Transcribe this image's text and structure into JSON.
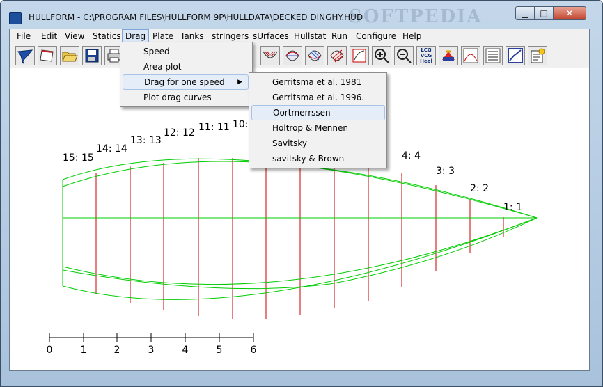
{
  "window": {
    "title": "HULLFORM - C:\\PROGRAM FILES\\HULLFORM 9P\\HULLDATA\\DECKED DINGHY.HUD",
    "watermark": "SOFTPEDIA"
  },
  "menubar": [
    "File",
    "Edit",
    "View",
    "Statics",
    "Drag",
    "Plate",
    "Tanks",
    "strIngers",
    "sUrfaces",
    "Hullstat",
    "Run",
    "Configure",
    "Help"
  ],
  "toolbar": {
    "icons": [
      "hull-3d-icon",
      "page-icon",
      "open-folder-icon",
      "save-disk-icon",
      "print-icon",
      "view-icon",
      "view-icon",
      "view-icon",
      "view-icon",
      "view-icon",
      "body-plan-icon",
      "plan-view-icon",
      "profile-icon",
      "lines-icon",
      "curve-plot-icon",
      "zoom-in-icon",
      "zoom-out-icon",
      "lcg-vcg-heel-icon",
      "stability-icon",
      "area-curve-icon",
      "data-table-icon",
      "speed-plot-icon",
      "export-icon"
    ],
    "lcg_label": "LCG VCG Heel"
  },
  "drag_menu": {
    "items": [
      "Speed",
      "Area plot",
      "Drag for one speed",
      "Plot drag curves"
    ],
    "highlighted": "Drag for one speed"
  },
  "submenu": {
    "items": [
      "Gerritsma et al. 1981",
      "Gerritsma et al. 1996.",
      "Oortmerrssen",
      "Holtrop & Mennen",
      "Savitsky",
      "savitsky & Brown"
    ],
    "highlighted": "Oortmerrssen"
  },
  "drawing": {
    "station_labels": [
      "15: 15",
      "14: 14",
      "13: 13",
      "12: 12",
      "11: 11",
      "10:",
      "4: 4",
      "3: 3",
      "2: 2",
      "1: 1"
    ],
    "scale_labels": [
      "0",
      "1",
      "2",
      "3",
      "4",
      "5",
      "6"
    ],
    "line_color": "#00cc00",
    "station_color": "#cc0000"
  }
}
